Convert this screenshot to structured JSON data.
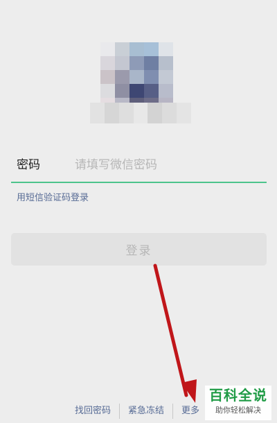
{
  "login": {
    "password_label": "密码",
    "password_placeholder": "请填写微信密码",
    "sms_login_link": "用短信验证码登录",
    "login_button": "登录"
  },
  "footer": {
    "items": [
      "找回密码",
      "紧急冻结",
      "更多"
    ]
  },
  "watermark": {
    "title": "百科全说",
    "subtitle": "助你轻松解决"
  },
  "colors": {
    "accent_line": "#4cc48c",
    "link": "#576b95",
    "annotation_arrow": "#c0161a",
    "watermark_green": "#1f9b45"
  }
}
